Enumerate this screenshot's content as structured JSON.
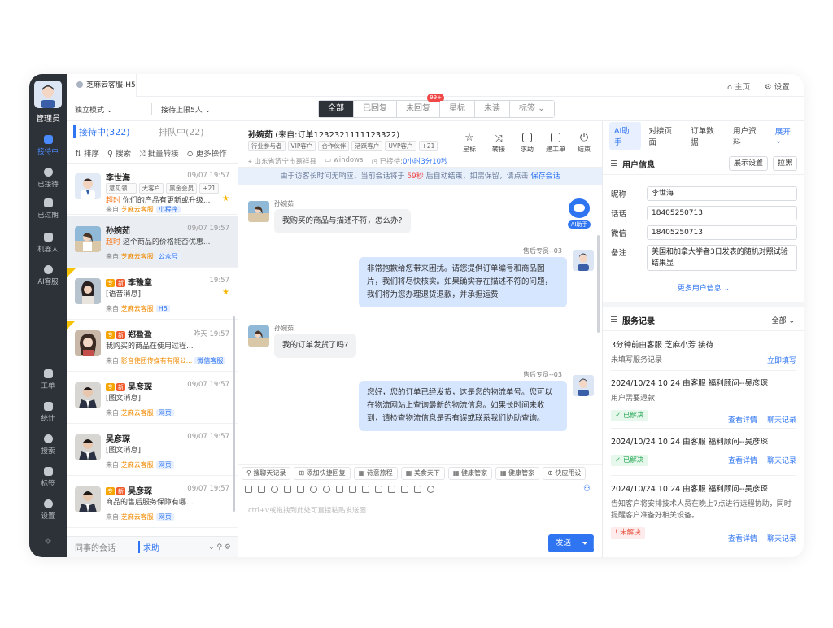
{
  "nav": {
    "user_label": "管理员",
    "items": [
      {
        "label": "接待中",
        "icon": "chat-bubble-icon"
      },
      {
        "label": "已接待",
        "icon": "check-circle-icon"
      },
      {
        "label": "已过期",
        "icon": "clock-icon"
      },
      {
        "label": "机器人",
        "icon": "robot-icon"
      },
      {
        "label": "AI客服",
        "icon": "ai-chat-icon"
      },
      {
        "label": "工单",
        "icon": "ticket-icon"
      },
      {
        "label": "统计",
        "icon": "bar-chart-icon"
      },
      {
        "label": "搜索",
        "icon": "search-icon"
      },
      {
        "label": "标签",
        "icon": "tag-icon"
      },
      {
        "label": "设置",
        "icon": "gear-icon"
      }
    ]
  },
  "topbar": {
    "app_tab": "芝麻云客服-H5",
    "home": "主页",
    "settings": "设置"
  },
  "filters": {
    "mode": "独立模式",
    "limit": "接待上限5人",
    "segments": [
      "全部",
      "已回复",
      "未回复",
      "星标",
      "未读",
      "标签"
    ],
    "unreplied_count": "99+"
  },
  "list": {
    "tab_active": "接待中(322)",
    "tab_queue": "排队中(22)",
    "tools": [
      "排序",
      "搜索",
      "批量转接",
      "更多操作"
    ],
    "items": [
      {
        "name": "李世海",
        "time": "09/07 19:57",
        "tags": [
          "意见领...",
          "大客户",
          "黑金会员",
          "+21"
        ],
        "hot": "超时",
        "msg": "你们的产品有更新或升级...",
        "from": "来自:",
        "org": "芝麻云客服",
        "channel": "小程序",
        "star": true
      },
      {
        "name": "孙婉茹",
        "time": "09/07 19:57",
        "hot": "超时",
        "msg": "这个商品的价格能否优惠...",
        "from": "来自:",
        "org": "芝麻云客服",
        "channel": "公众号"
      },
      {
        "name": "李豫章",
        "time": "19:57",
        "b1": "专",
        "b2": "新",
        "msg": "[语音消息]",
        "from": "来自:",
        "org": "芝麻云客服",
        "channel": "H5",
        "star": true
      },
      {
        "name": "郑盈盈",
        "time": "昨天 19:57",
        "b1": "专",
        "b2": "新",
        "msg": "我购买的商品在使用过程...",
        "from": "来自:",
        "org": "影音使团传媒有有限公...",
        "channel": "微信客服"
      },
      {
        "name": "吴彦琛",
        "time": "09/07 19:57",
        "b1": "专",
        "b2": "新",
        "msg": "[图文消息]",
        "from": "来自:",
        "org": "芝麻云客服",
        "channel": "网页"
      },
      {
        "name": "吴彦琛",
        "time": "09/07 19:57",
        "msg": "[图文消息]",
        "from": "来自:",
        "org": "芝麻云客服",
        "channel": "网页"
      },
      {
        "name": "吴彦琛",
        "time": "09/07 19:57",
        "b1": "专",
        "b2": "新",
        "msg": "商品的售后服务保障有哪...",
        "from": "来自:",
        "org": "芝麻云客服",
        "channel": "网页"
      }
    ],
    "footer_left": "同事的会话",
    "footer_help": "求助"
  },
  "chat": {
    "title": "孙婉茹",
    "source": "(来自:订单1232321111123322)",
    "tags": [
      "行业参与者",
      "VIP客户",
      "合作伙伴",
      "活跃客户",
      "UVP客户",
      "+21"
    ],
    "location": "山东省济宁市嘉祥县",
    "os": "windows",
    "served_label": "已接待:",
    "served": "0小时3分10秒",
    "actions": [
      "星标",
      "转接",
      "求助",
      "建工单",
      "结束"
    ],
    "notice_pre": "由于访客长时间无响应，当前会话将于",
    "notice_sec": "59秒",
    "notice_mid": "后自动结束，如需保留，请点击",
    "notice_keep": "保存会话",
    "ai_label": "AI助手",
    "messages": [
      {
        "side": "left",
        "sender": "孙婉茹",
        "text": "我购买的商品与描述不符，怎么办?"
      },
      {
        "side": "right",
        "sender": "售后专员--03",
        "text": "非常抱歉给您带来困扰。请您提供订单编号和商品图片，我们将尽快核实。如果确实存在描述不符的问题，我们将为您办理退货退款，并承担运费"
      },
      {
        "side": "left",
        "sender": "孙婉茹",
        "text": "我的订单发货了吗?"
      },
      {
        "side": "right",
        "sender": "售后专员--03",
        "text": "您好，您的订单已经发货，这是您的物流单号。您可以在物流网站上查询最新的物流信息。如果长时间未收到，请检查物流信息是否有误或联系我们协助查询。"
      }
    ],
    "quick_replies": [
      "搜聊天记录",
      "添加快捷回复",
      "诗意旅程",
      "美食天下",
      "健康管家",
      "健康管家",
      "快应用设"
    ],
    "input_placeholder": "ctrl+v或拖拽到此处可直接粘贴发送图",
    "send": "发送"
  },
  "right": {
    "tabs": [
      "AI助手",
      "对接页面",
      "订单数据",
      "用户资料"
    ],
    "expand": "展开",
    "user_info": {
      "title": "用户信息",
      "btn_display": "展示设置",
      "btn_black": "拉黑",
      "nick_label": "昵称",
      "nick": "李世海",
      "phone_label": "话话",
      "phone": "18405250713",
      "wechat_label": "微信",
      "wechat": "18405250713",
      "note_label": "备注",
      "note": "美国和加拿大学者3日发表的随机对照试验结果显",
      "more": "更多用户信息"
    },
    "service": {
      "title": "服务记录",
      "filter": "全部",
      "first_line": "3分钟前由客服 芝麻小芳 接待",
      "first_empty": "未填写服务记录",
      "first_link": "立即填写",
      "records": [
        {
          "line": "2024/10/24 10:24 由客服 福利顾问--吴彦琛",
          "note": "用户需要退款",
          "status": "已解决",
          "ok": true
        },
        {
          "line": "2024/10/24 10:24 由客服 福利顾问--吴彦琛",
          "note": "",
          "status": "已解决",
          "ok": true
        },
        {
          "line": "2024/10/24 10:24 由客服 福利顾问--吴彦琛",
          "note": "告知客户将安排技术人员在晚上7点进行远程协助，同时提醒客户准备好相关设备。",
          "status": "未解决",
          "ok": false
        }
      ],
      "detail": "查看详情",
      "history": "聊天记录"
    }
  },
  "colors": {
    "accent": "#2f75f2",
    "nav_bg": "#2d3138",
    "star": "#f7b500",
    "timeout": "#f5761a"
  }
}
